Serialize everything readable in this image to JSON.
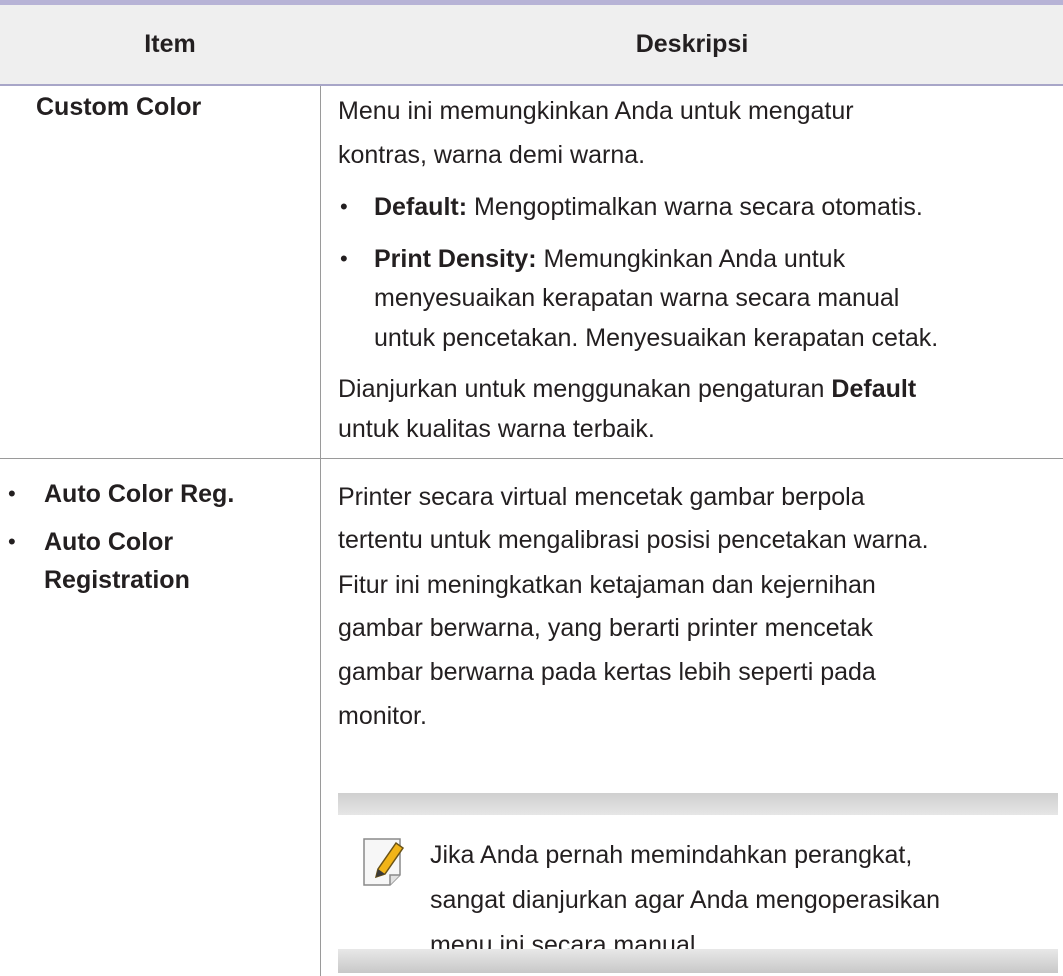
{
  "table": {
    "headers": {
      "item": "Item",
      "description": "Deskripsi"
    },
    "row1": {
      "item": "Custom Color",
      "desc_line1": "Menu ini memungkinkan Anda untuk mengatur",
      "desc_line2": "kontras, warna demi warna.",
      "bullets": [
        {
          "bullet": "•",
          "label": "Default:",
          "text": "Mengoptimalkan warna secara otomatis."
        },
        {
          "bullet": "•",
          "label": "Print Density:",
          "text": "Memungkinkan Anda untuk",
          "cont1": "menyesuaikan kerapatan warna secara manual",
          "cont2": "untuk pencetakan. Menyesuaikan kerapatan cetak."
        }
      ],
      "footer_pre": "Dianjurkan untuk menggunakan pengaturan",
      "footer_bold": "Default",
      "footer_line2": "untuk kualitas warna terbaik."
    },
    "row2": {
      "items": [
        {
          "bullet": "•",
          "line1": "Auto Color Reg."
        },
        {
          "bullet": "•",
          "line1": "Auto Color",
          "line2": "Registration"
        }
      ],
      "desc_lines": [
        "Printer secara virtual mencetak gambar berpola",
        "tertentu untuk mengalibrasi posisi pencetakan warna.",
        "Fitur ini meningkatkan ketajaman dan kejernihan",
        "gambar berwarna, yang berarti printer mencetak",
        "gambar berwarna pada kertas lebih seperti pada",
        "monitor."
      ],
      "note": {
        "icon": "note-pencil-icon",
        "lines": [
          "Jika Anda pernah memindahkan perangkat,",
          "sangat dianjurkan agar Anda mengoperasikan",
          "menu ini secara manual."
        ]
      }
    }
  },
  "colors": {
    "header_bg": "#efefef",
    "header_rule": "#b7b3d6",
    "grid": "#9a9a9a",
    "text": "#231f20",
    "note_bar": "#d0d0d0",
    "icon_accent": "#f2b418"
  }
}
